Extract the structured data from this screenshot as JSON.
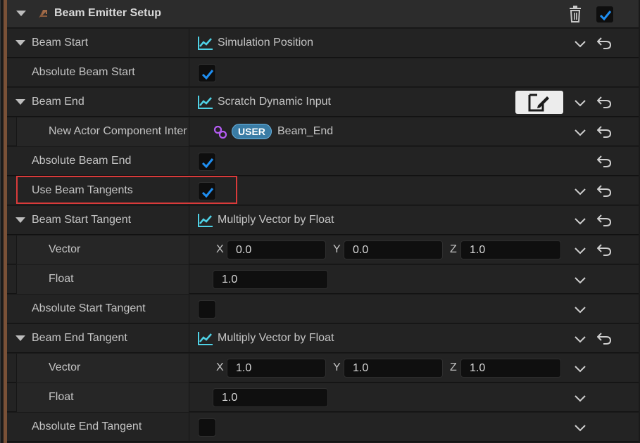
{
  "header": {
    "title": "Beam Emitter Setup",
    "enabled": true
  },
  "rows": {
    "beam_start": {
      "label": "Beam Start",
      "value": "Simulation Position"
    },
    "absolute_beam_start": {
      "label": "Absolute Beam Start",
      "checked": true
    },
    "beam_end": {
      "label": "Beam End",
      "value": "Scratch Dynamic Input"
    },
    "new_actor": {
      "label": "New Actor Component Inter",
      "user_badge": "USER",
      "value": "Beam_End"
    },
    "absolute_beam_end": {
      "label": "Absolute Beam End",
      "checked": true
    },
    "use_beam_tangents": {
      "label": "Use Beam Tangents",
      "checked": true
    },
    "beam_start_tangent": {
      "label": "Beam Start Tangent",
      "value": "Multiply Vector by Float"
    },
    "start_vector": {
      "label": "Vector",
      "x": "0.0",
      "y": "0.0",
      "z": "1.0"
    },
    "start_float": {
      "label": "Float",
      "value": "1.0"
    },
    "absolute_start_tangent": {
      "label": "Absolute Start Tangent",
      "checked": false
    },
    "beam_end_tangent": {
      "label": "Beam End Tangent",
      "value": "Multiply Vector by Float"
    },
    "end_vector": {
      "label": "Vector",
      "x": "1.0",
      "y": "1.0",
      "z": "1.0"
    },
    "end_float": {
      "label": "Float",
      "value": "1.0"
    },
    "absolute_end_tangent": {
      "label": "Absolute End Tangent",
      "checked": false
    }
  },
  "axes": {
    "x": "X",
    "y": "Y",
    "z": "Z"
  },
  "colors": {
    "accent": "#7a5137",
    "check_blue": "#1f8ff2",
    "curve_cyan": "#4fd2e6",
    "link_purple": "#b45cf2",
    "user_pill": "#3a7ca5",
    "highlight": "#d93a3a"
  }
}
